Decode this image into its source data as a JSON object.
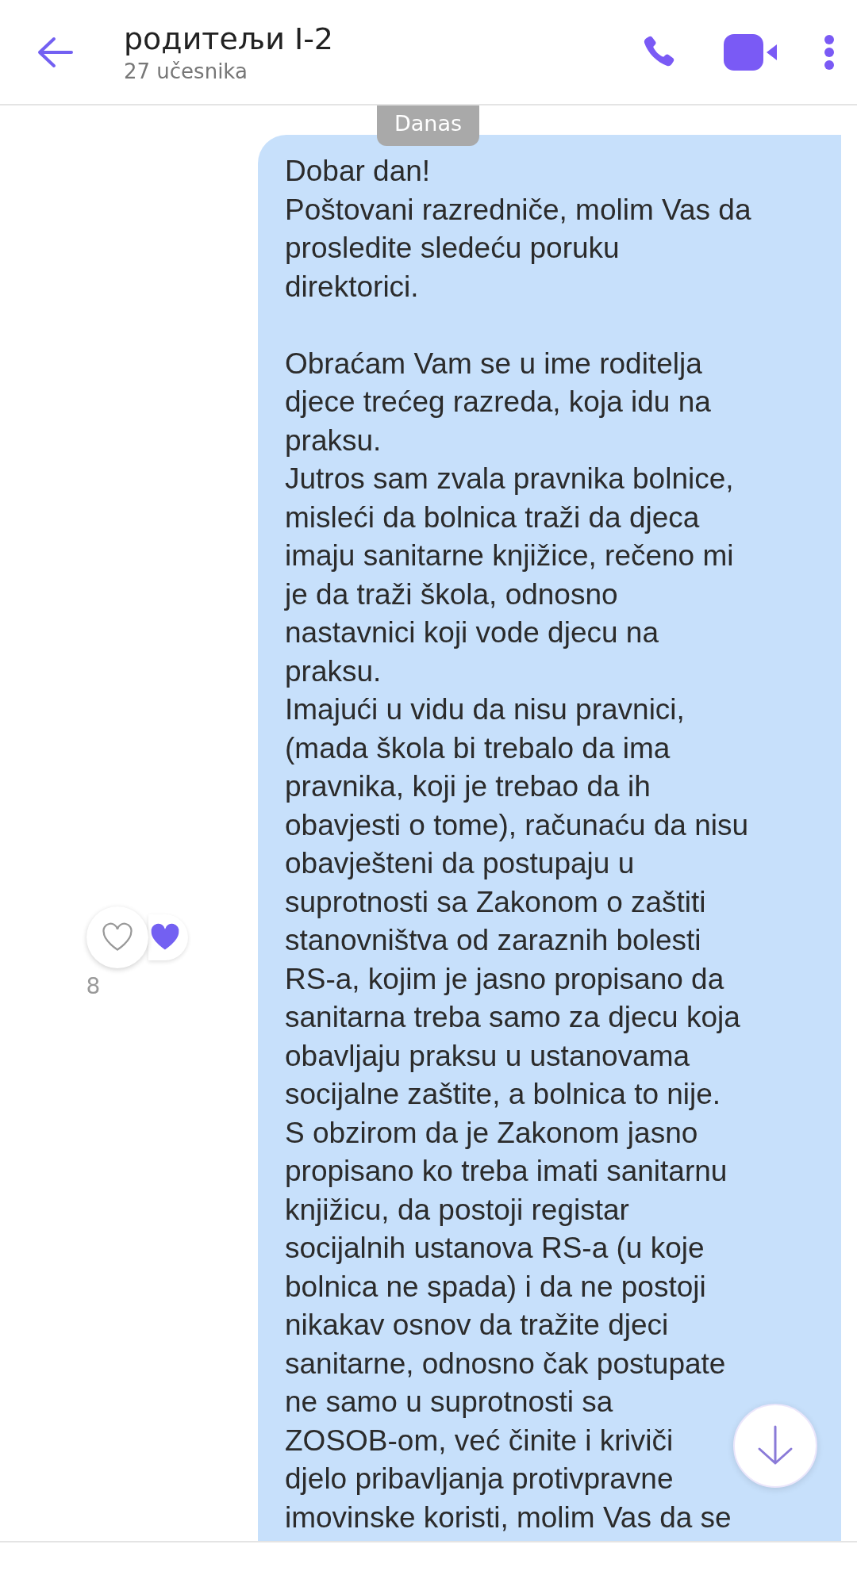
{
  "header": {
    "title": "родитељи I-2",
    "subtitle": "27 učesnika"
  },
  "date_label": "Danas",
  "message": {
    "paragraphs": [
      "Dobar dan!\nPoštovani razredniče, molim Vas da\nprosledite sledeću poruku\ndirektorici.",
      "Obraćam Vam se u ime roditelja\ndjece trećeg razreda, koja idu na\npraksu.",
      "Jutros sam zvala pravnika bolnice,\nmisleći da bolnica traži da djeca\nimaju sanitarne knjižice, rečeno mi\nje da traži škola, odnosno\nnastavnici koji vode djecu na\npraksu.",
      "Imajući u vidu da nisu pravnici,\n(mada škola bi trebalo da ima\npravnika, koji je trebao da ih\nobavjesti o tome), računaću da nisu\nobavješteni da postupaju u\nsuprotnosti sa Zakonom o zaštiti\nstanovništva od zaraznih bolesti\nRS-a, kojim je jasno propisano da\nsanitarna treba samo za djecu koja\nobavljaju praksu u ustanovama\nsocijalne zaštite, a bolnica to nije.",
      "S obzirom da je Zakonom jasno\npropisano ko treba imati sanitarnu\nknjižicu, da postoji registar\nsocijalnih ustanova RS-a (u koje\nbolnica ne spada) i da ne postoji\nnikakav osnov da tražite djeci\nsanitarne, odnosno čak postupate\nne samo u suprotnosti sa\nZOSOB-om, već činite i kriviči\ndjelo pribavljanja protivpravne\nimovinske koristi, molim Vas da se"
    ],
    "like_count": "8"
  }
}
